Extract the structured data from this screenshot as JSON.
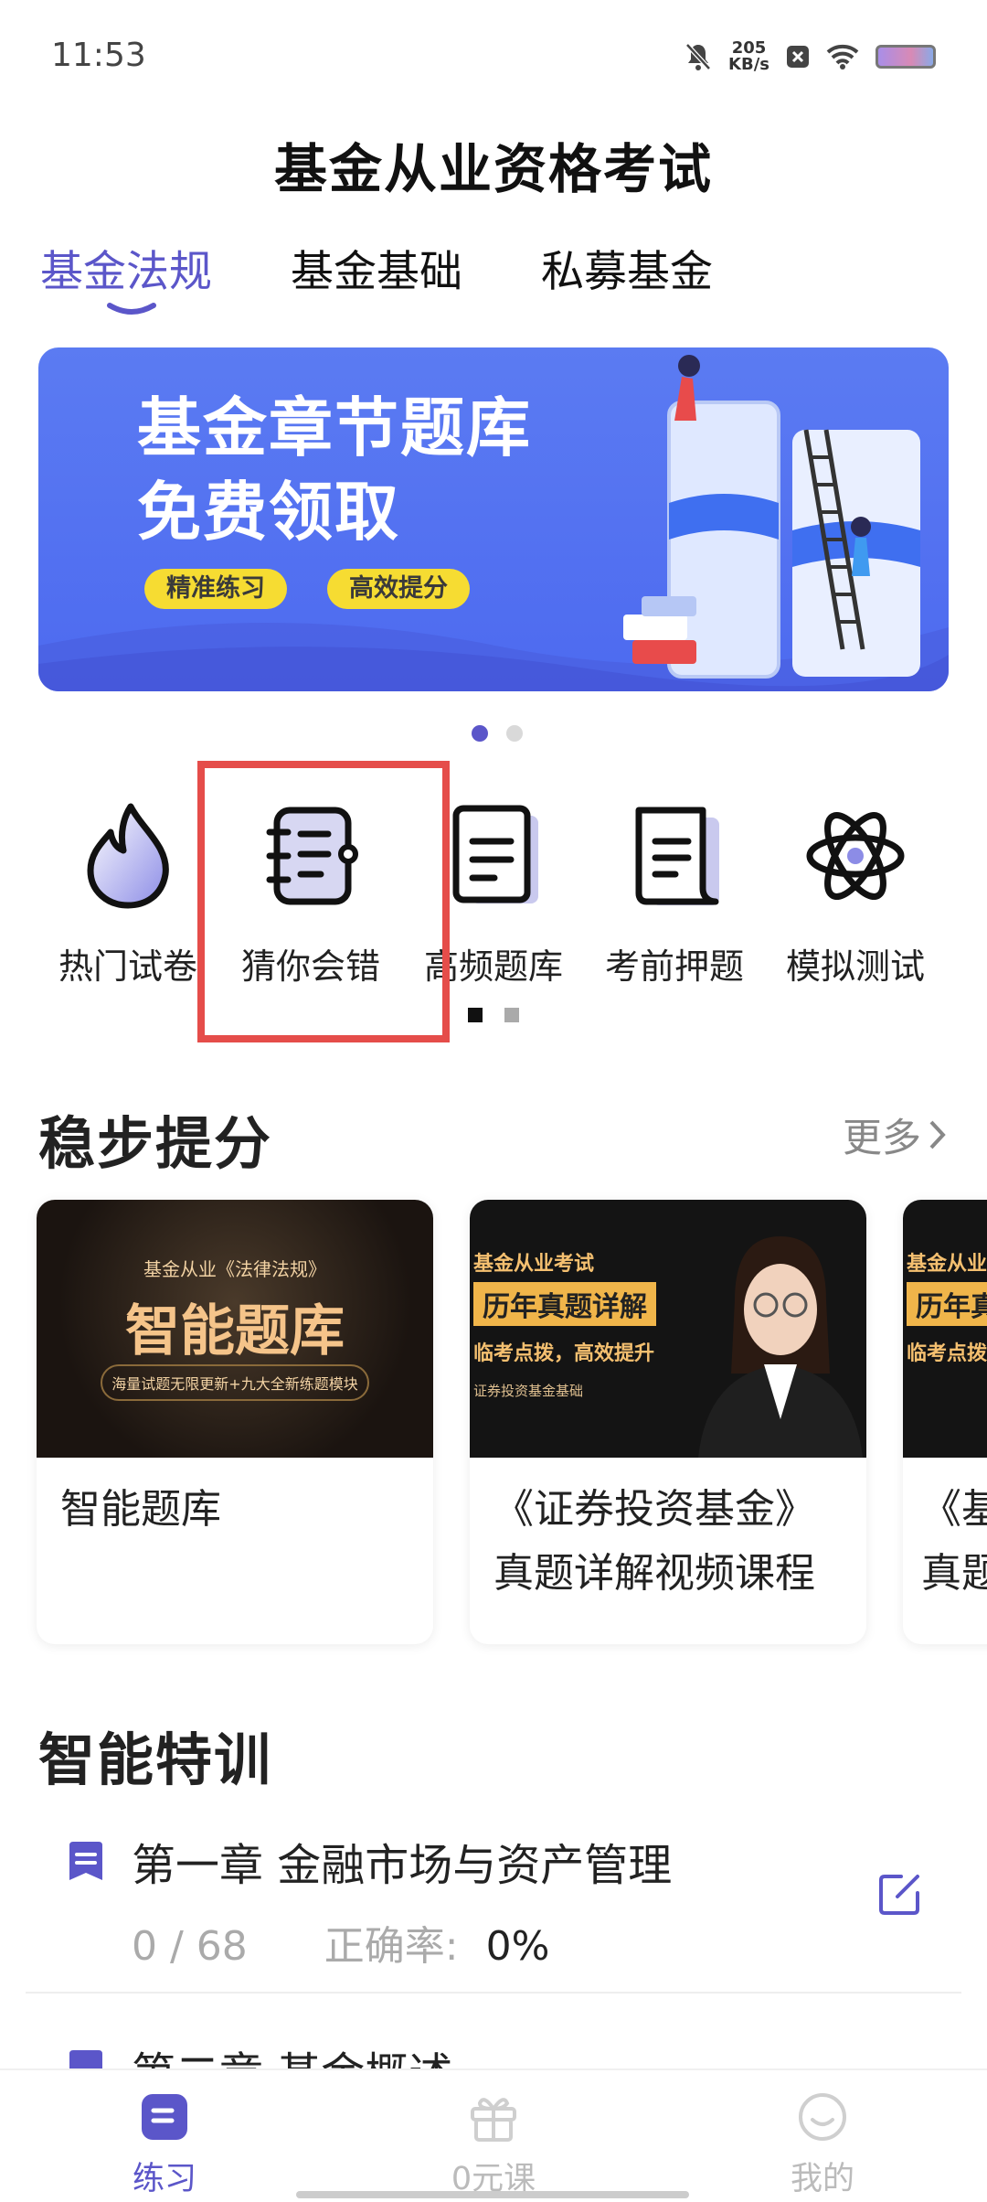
{
  "status_bar": {
    "time": "11:53",
    "speed_top": "205",
    "speed_bottom": "KB/s"
  },
  "header": {
    "title": "基金从业资格考试"
  },
  "tabs": [
    {
      "label": "基金法规",
      "active": true
    },
    {
      "label": "基金基础",
      "active": false
    },
    {
      "label": "私募基金",
      "active": false
    }
  ],
  "banner": {
    "line1": "基金章节题库",
    "line2": "免费领取",
    "tag1": "精准练习",
    "tag2": "高效提分",
    "page_index": 1,
    "page_count": 2
  },
  "shortcuts": [
    {
      "label": "热门试卷",
      "icon": "flame-icon"
    },
    {
      "label": "猜你会错",
      "icon": "notebook-icon"
    },
    {
      "label": "高频题库",
      "icon": "document-icon"
    },
    {
      "label": "考前押题",
      "icon": "scroll-document-icon"
    },
    {
      "label": "模拟测试",
      "icon": "atom-icon"
    }
  ],
  "steady": {
    "title": "稳步提分",
    "more": "更多",
    "cards": [
      {
        "title": "智能题库",
        "img_top": "基金从业《法律法规》",
        "img_main": "智能题库",
        "img_sub": "海量试题无限更新+九大全新练题模块"
      },
      {
        "title": "《证券投资基金》真题详解视频课程",
        "img_top": "基金从业考试",
        "img_main": "历年真题详解",
        "img_sub": "临考点拨，高效提升",
        "img_tag": "证券投资基金基础"
      },
      {
        "title": "《基",
        "title2": "真题",
        "img_top": "基金从业考",
        "img_main": "历年真",
        "img_sub": "临考点拨"
      }
    ]
  },
  "training": {
    "title": "智能特训",
    "chapters": [
      {
        "title": "第一章  金融市场与资产管理",
        "progress": "0 / 68",
        "accuracy_label": "正确率:",
        "accuracy": "0%"
      },
      {
        "title": "第二章  基金概述"
      }
    ]
  },
  "bottom_nav": [
    {
      "label": "练习",
      "active": true
    },
    {
      "label": "0元课",
      "active": false
    },
    {
      "label": "我的",
      "active": false
    }
  ],
  "colors": {
    "accent": "#5b56c9",
    "banner": "#5b7bf2",
    "highlight": "#e54d4a"
  }
}
